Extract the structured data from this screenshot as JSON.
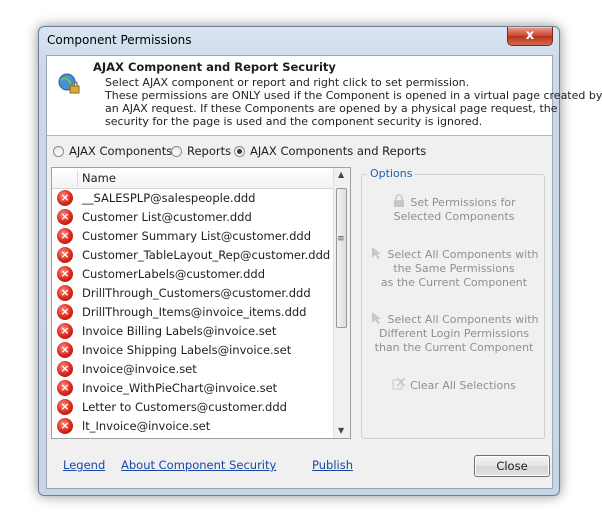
{
  "window": {
    "title": "Component Permissions",
    "close_glyph": "x"
  },
  "header": {
    "title": "AJAX Component and Report Security",
    "desc_lines": [
      "Select AJAX component or report and right click to set permission.",
      "These permissions are ONLY used if the Component is opened in a virtual page created by",
      "an AJAX request. If these Components are opened by a physical page request, the",
      "security for the page is used and the component security is ignored."
    ]
  },
  "filter": {
    "options": [
      "AJAX Components",
      "Reports",
      "AJAX Components and Reports"
    ],
    "selected": "AJAX Components and Reports"
  },
  "list": {
    "column": "Name",
    "items": [
      "__SALESPLP@salespeople.ddd",
      "Customer List@customer.ddd",
      "Customer Summary List@customer.ddd",
      "Customer_TableLayout_Rep@customer.ddd",
      "CustomerLabels@customer.ddd",
      "DrillThrough_Customers@customer.ddd",
      "DrillThrough_Items@invoice_items.ddd",
      "Invoice Billing Labels@invoice.set",
      "Invoice Shipping Labels@invoice.set",
      "Invoice@invoice.set",
      "Invoice_WithPieChart@invoice.set",
      "Letter to Customers@customer.ddd",
      "lt_Invoice@invoice.set"
    ]
  },
  "options": {
    "title": "Options",
    "set_permissions": [
      "Set Permissions for",
      "Selected Components"
    ],
    "select_same": [
      "Select All Components with",
      "the Same Permissions",
      "as the Current Component"
    ],
    "select_different": [
      "Select All Components with",
      "Different Login Permissions",
      "than the Current Component"
    ],
    "clear": "Clear All Selections"
  },
  "footer": {
    "legend": "Legend",
    "about": "About Component Security",
    "publish": "Publish",
    "close": "Close"
  }
}
